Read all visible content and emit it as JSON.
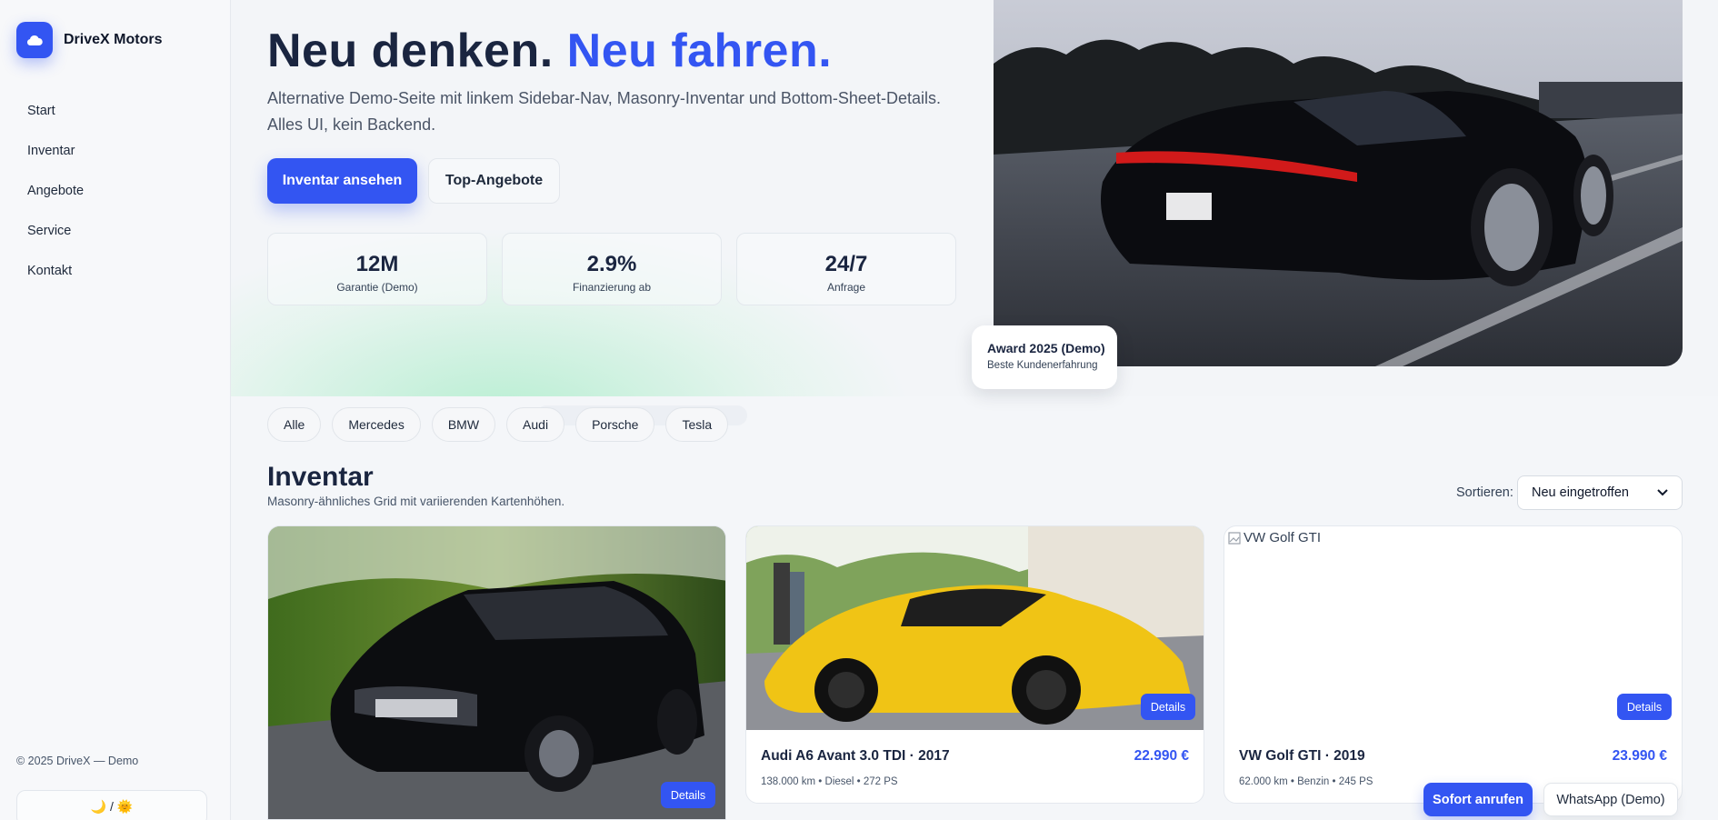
{
  "brand": {
    "name": "DriveX Motors",
    "logo_icon": "cloud-icon",
    "color": "#3355f2"
  },
  "nav": {
    "items": [
      {
        "label": "Start"
      },
      {
        "label": "Inventar"
      },
      {
        "label": "Angebote"
      },
      {
        "label": "Service"
      },
      {
        "label": "Kontakt"
      }
    ]
  },
  "footer": {
    "copyright": "© 2025 DriveX — Demo",
    "theme_toggle": "🌙 / 🌞"
  },
  "hero": {
    "title_main": "Neu denken.",
    "title_accent": "Neu fahren.",
    "subtitle": "Alternative Demo-Seite mit linkem Sidebar-Nav, Masonry-Inventar und Bottom-Sheet-Details. Alles UI, kein Backend.",
    "primary_button": "Inventar ansehen",
    "secondary_button": "Top-Angebote",
    "stats": [
      {
        "value": "12M",
        "label": "Garantie (Demo)"
      },
      {
        "value": "2.9%",
        "label": "Finanzierung ab"
      },
      {
        "value": "24/7",
        "label": "Anfrage"
      }
    ],
    "image_icon": "black-porsche-photo",
    "award": {
      "title": "Award 2025 (Demo)",
      "subtitle": "Beste Kundenerfahrung"
    }
  },
  "filters": [
    "Alle",
    "Mercedes",
    "BMW",
    "Audi",
    "Porsche",
    "Tesla"
  ],
  "inventory": {
    "title": "Inventar",
    "subtitle": "Masonry-ähnliches Grid mit variierenden Kartenhöhen.",
    "sort_label": "Sortieren:",
    "sort_value": "Neu eingetroffen",
    "details_label": "Details",
    "cards": [
      {
        "image": "black-sedan-photo"
      },
      {
        "name": "Audi A6 Avant 3.0 TDI · 2017",
        "price": "22.990 €",
        "specs": "138.000 km • Diesel • 272 PS",
        "image": "yellow-sportscar-photo"
      },
      {
        "name": "VW Golf GTI · 2019",
        "price": "23.990 €",
        "specs": "62.000 km • Benzin • 245 PS",
        "image_alt": "VW Golf GTI"
      }
    ]
  },
  "actions": {
    "call": "Sofort anrufen",
    "whatsapp": "WhatsApp (Demo)"
  },
  "colors": {
    "accent": "#3355f2",
    "heading": "#1a2540",
    "background": "#f4f6f9"
  }
}
